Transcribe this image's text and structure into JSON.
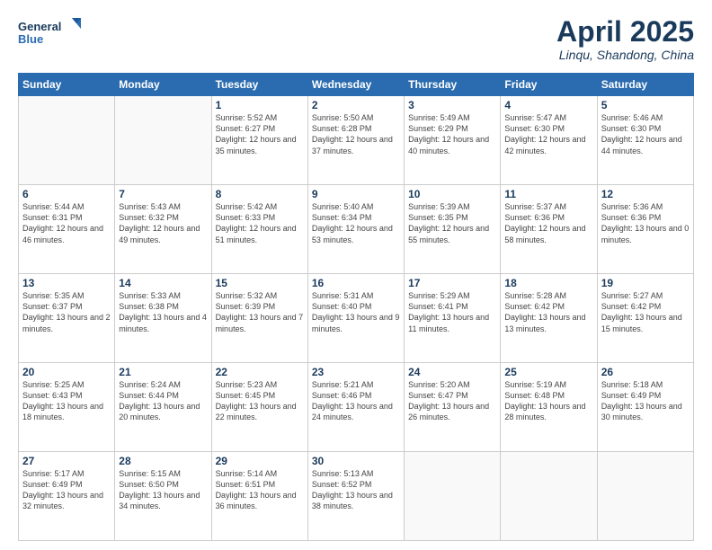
{
  "header": {
    "logo_line1": "General",
    "logo_line2": "Blue",
    "title": "April 2025",
    "subtitle": "Linqu, Shandong, China"
  },
  "days_of_week": [
    "Sunday",
    "Monday",
    "Tuesday",
    "Wednesday",
    "Thursday",
    "Friday",
    "Saturday"
  ],
  "weeks": [
    [
      {
        "day": null
      },
      {
        "day": null
      },
      {
        "day": "1",
        "sunrise": "5:52 AM",
        "sunset": "6:27 PM",
        "daylight": "12 hours and 35 minutes."
      },
      {
        "day": "2",
        "sunrise": "5:50 AM",
        "sunset": "6:28 PM",
        "daylight": "12 hours and 37 minutes."
      },
      {
        "day": "3",
        "sunrise": "5:49 AM",
        "sunset": "6:29 PM",
        "daylight": "12 hours and 40 minutes."
      },
      {
        "day": "4",
        "sunrise": "5:47 AM",
        "sunset": "6:30 PM",
        "daylight": "12 hours and 42 minutes."
      },
      {
        "day": "5",
        "sunrise": "5:46 AM",
        "sunset": "6:30 PM",
        "daylight": "12 hours and 44 minutes."
      }
    ],
    [
      {
        "day": "6",
        "sunrise": "5:44 AM",
        "sunset": "6:31 PM",
        "daylight": "12 hours and 46 minutes."
      },
      {
        "day": "7",
        "sunrise": "5:43 AM",
        "sunset": "6:32 PM",
        "daylight": "12 hours and 49 minutes."
      },
      {
        "day": "8",
        "sunrise": "5:42 AM",
        "sunset": "6:33 PM",
        "daylight": "12 hours and 51 minutes."
      },
      {
        "day": "9",
        "sunrise": "5:40 AM",
        "sunset": "6:34 PM",
        "daylight": "12 hours and 53 minutes."
      },
      {
        "day": "10",
        "sunrise": "5:39 AM",
        "sunset": "6:35 PM",
        "daylight": "12 hours and 55 minutes."
      },
      {
        "day": "11",
        "sunrise": "5:37 AM",
        "sunset": "6:36 PM",
        "daylight": "12 hours and 58 minutes."
      },
      {
        "day": "12",
        "sunrise": "5:36 AM",
        "sunset": "6:36 PM",
        "daylight": "13 hours and 0 minutes."
      }
    ],
    [
      {
        "day": "13",
        "sunrise": "5:35 AM",
        "sunset": "6:37 PM",
        "daylight": "13 hours and 2 minutes."
      },
      {
        "day": "14",
        "sunrise": "5:33 AM",
        "sunset": "6:38 PM",
        "daylight": "13 hours and 4 minutes."
      },
      {
        "day": "15",
        "sunrise": "5:32 AM",
        "sunset": "6:39 PM",
        "daylight": "13 hours and 7 minutes."
      },
      {
        "day": "16",
        "sunrise": "5:31 AM",
        "sunset": "6:40 PM",
        "daylight": "13 hours and 9 minutes."
      },
      {
        "day": "17",
        "sunrise": "5:29 AM",
        "sunset": "6:41 PM",
        "daylight": "13 hours and 11 minutes."
      },
      {
        "day": "18",
        "sunrise": "5:28 AM",
        "sunset": "6:42 PM",
        "daylight": "13 hours and 13 minutes."
      },
      {
        "day": "19",
        "sunrise": "5:27 AM",
        "sunset": "6:42 PM",
        "daylight": "13 hours and 15 minutes."
      }
    ],
    [
      {
        "day": "20",
        "sunrise": "5:25 AM",
        "sunset": "6:43 PM",
        "daylight": "13 hours and 18 minutes."
      },
      {
        "day": "21",
        "sunrise": "5:24 AM",
        "sunset": "6:44 PM",
        "daylight": "13 hours and 20 minutes."
      },
      {
        "day": "22",
        "sunrise": "5:23 AM",
        "sunset": "6:45 PM",
        "daylight": "13 hours and 22 minutes."
      },
      {
        "day": "23",
        "sunrise": "5:21 AM",
        "sunset": "6:46 PM",
        "daylight": "13 hours and 24 minutes."
      },
      {
        "day": "24",
        "sunrise": "5:20 AM",
        "sunset": "6:47 PM",
        "daylight": "13 hours and 26 minutes."
      },
      {
        "day": "25",
        "sunrise": "5:19 AM",
        "sunset": "6:48 PM",
        "daylight": "13 hours and 28 minutes."
      },
      {
        "day": "26",
        "sunrise": "5:18 AM",
        "sunset": "6:49 PM",
        "daylight": "13 hours and 30 minutes."
      }
    ],
    [
      {
        "day": "27",
        "sunrise": "5:17 AM",
        "sunset": "6:49 PM",
        "daylight": "13 hours and 32 minutes."
      },
      {
        "day": "28",
        "sunrise": "5:15 AM",
        "sunset": "6:50 PM",
        "daylight": "13 hours and 34 minutes."
      },
      {
        "day": "29",
        "sunrise": "5:14 AM",
        "sunset": "6:51 PM",
        "daylight": "13 hours and 36 minutes."
      },
      {
        "day": "30",
        "sunrise": "5:13 AM",
        "sunset": "6:52 PM",
        "daylight": "13 hours and 38 minutes."
      },
      {
        "day": null
      },
      {
        "day": null
      },
      {
        "day": null
      }
    ]
  ]
}
